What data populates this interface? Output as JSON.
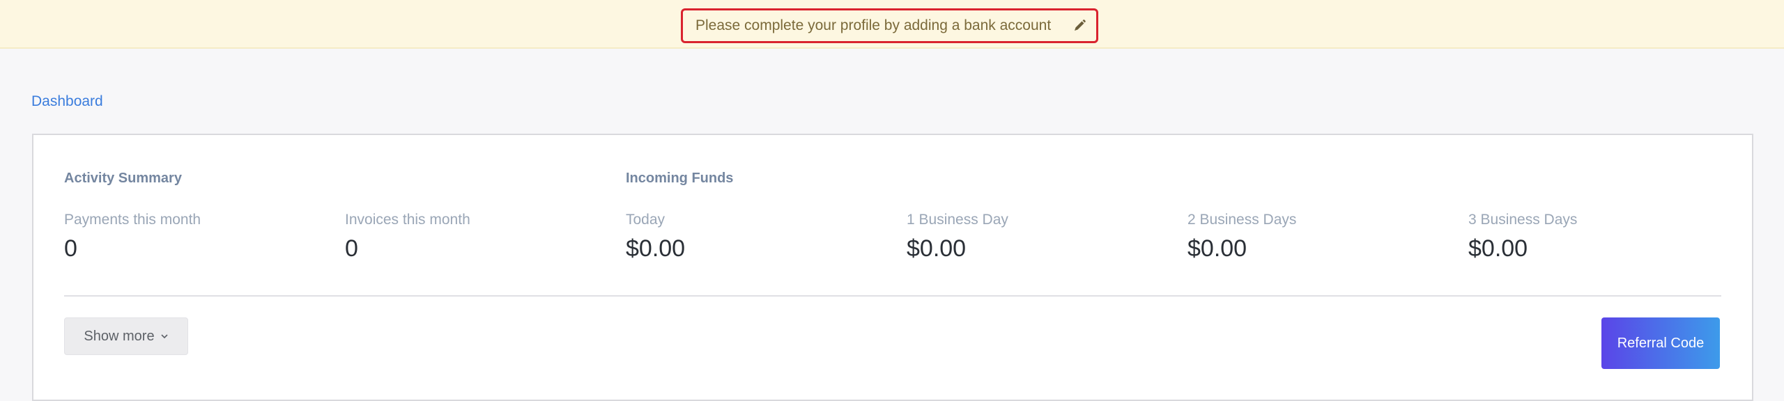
{
  "banner": {
    "message": "Please complete your profile by adding a bank account",
    "edit_icon": "pencil-icon"
  },
  "breadcrumb": {
    "label": "Dashboard"
  },
  "activity_summary": {
    "title": "Activity Summary",
    "stats": [
      {
        "label": "Payments this month",
        "value": "0"
      },
      {
        "label": "Invoices this month",
        "value": "0"
      }
    ]
  },
  "incoming_funds": {
    "title": "Incoming Funds",
    "stats": [
      {
        "label": "Today",
        "value": "$0.00"
      },
      {
        "label": "1 Business Day",
        "value": "$0.00"
      },
      {
        "label": "2 Business Days",
        "value": "$0.00"
      },
      {
        "label": "3 Business Days",
        "value": "$0.00"
      }
    ]
  },
  "actions": {
    "show_more_label": "Show more",
    "show_more_icon": "chevron-down-icon",
    "referral_label": "Referral Code"
  },
  "colors": {
    "accent_start": "#5a45e8",
    "accent_end": "#3d9bea",
    "banner_bg": "#fdf7e1",
    "banner_border": "#d9232e",
    "link": "#3b7ddd"
  }
}
